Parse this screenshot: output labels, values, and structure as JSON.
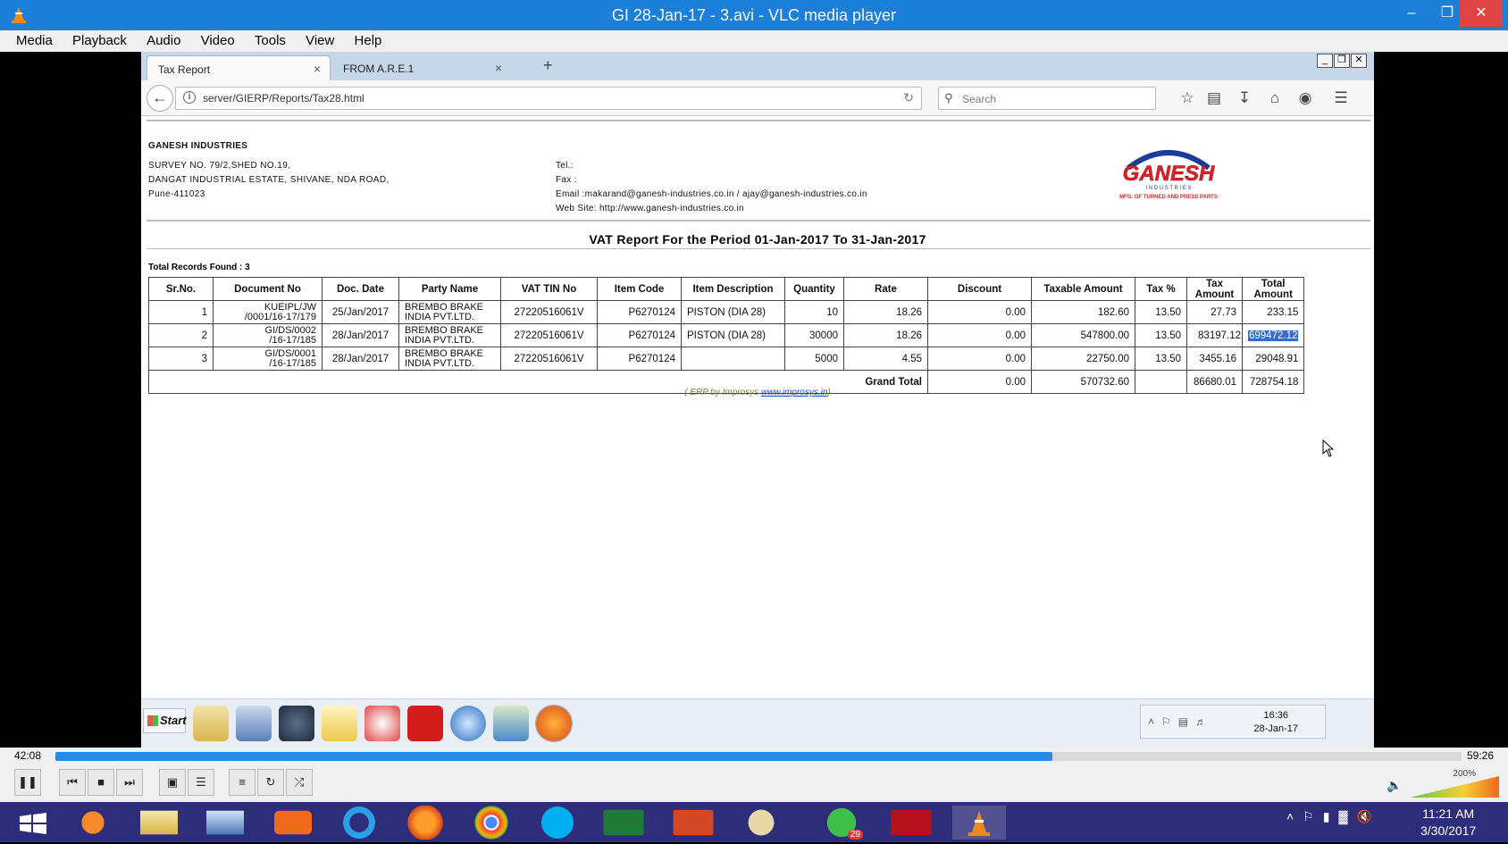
{
  "vlc": {
    "title": "GI 28-Jan-17 - 3.avi - VLC media player",
    "menu": [
      "Media",
      "Playback",
      "Audio",
      "Video",
      "Tools",
      "View",
      "Help"
    ],
    "time_elapsed": "42:08",
    "time_total": "59:26",
    "progress": 0.709,
    "volume": "200%"
  },
  "browser": {
    "tabs": [
      {
        "label": "Tax Report",
        "active": true
      },
      {
        "label": "FROM A.R.E.1",
        "active": false
      }
    ],
    "url": "server/GIERP/Reports/Tax28.html",
    "search_placeholder": "Search"
  },
  "report": {
    "company": "GANESH INDUSTRIES",
    "address": [
      "SURVEY NO. 79/2,SHED NO.19,",
      "DANGAT INDUSTRIAL ESTATE, SHIVANE, NDA ROAD,",
      "Pune-411023"
    ],
    "tel": "Tel.:",
    "fax": "Fax :",
    "email": "Email :makarand@ganesh-industries.co.in / ajay@ganesh-industries.co.in",
    "website": "Web Site: http://www.ganesh-industries.co.in",
    "logo_text": "GANESH",
    "logo_sub": "I N D U S T R I E S",
    "logo_tagline": "MFG. OF TURNED AND PRESS PARTS",
    "title": "VAT Report For the Period 01-Jan-2017 To 31-Jan-2017",
    "records": "Total Records Found : 3",
    "columns": [
      "Sr.No.",
      "Document No",
      "Doc. Date",
      "Party Name",
      "VAT TIN No",
      "Item Code",
      "Item Description",
      "Quantity",
      "Rate",
      "Discount",
      "Taxable Amount",
      "Tax %",
      "Tax Amount",
      "Total Amount"
    ],
    "rows": [
      {
        "sr": "1",
        "doc1": "KUEIPL/JW",
        "doc2": "/0001/16-17/179",
        "date": "25/Jan/2017",
        "party1": "BREMBO BRAKE",
        "party2": "INDIA PVT.LTD.",
        "tin": "27220516061V",
        "code": "P6270124",
        "desc": "PISTON (DIA 28)",
        "qty": "10",
        "rate": "18.26",
        "disc": "0.00",
        "taxable": "182.60",
        "taxpct": "13.50",
        "taxamt": "27.73",
        "total": "233.15"
      },
      {
        "sr": "2",
        "doc1": "GI/DS/0002",
        "doc2": "/16-17/185",
        "date": "28/Jan/2017",
        "party1": "BREMBO BRAKE",
        "party2": "INDIA PVT.LTD.",
        "tin": "27220516061V",
        "code": "P6270124",
        "desc": "PISTON (DIA 28)",
        "qty": "30000",
        "rate": "18.26",
        "disc": "0.00",
        "taxable": "547800.00",
        "taxpct": "13.50",
        "taxamt": "83197.12",
        "total": "699472.12"
      },
      {
        "sr": "3",
        "doc1": "GI/DS/0001",
        "doc2": "/16-17/185",
        "date": "28/Jan/2017",
        "party1": "BREMBO BRAKE",
        "party2": "INDIA PVT.LTD.",
        "tin": "27220516061V",
        "code": "P6270124",
        "desc": "",
        "qty": "5000",
        "rate": "4.55",
        "disc": "0.00",
        "taxable": "22750.00",
        "taxpct": "13.50",
        "taxamt": "3455.16",
        "total": "29048.91"
      }
    ],
    "grand_total_label": "Grand Total",
    "grand_total": {
      "disc": "0.00",
      "taxable": "570732.60",
      "taxamt": "86680.01",
      "total": "728754.18"
    },
    "footer_prefix": "( ERP by Improsys ",
    "footer_link": "www.improsys.in",
    "footer_suffix": ")"
  },
  "inner_taskbar": {
    "start": "Start",
    "time": "16:36",
    "date": "28-Jan-17"
  },
  "windows": {
    "time": "11:21 AM",
    "date": "3/30/2017",
    "whatsapp_badge": "29"
  }
}
